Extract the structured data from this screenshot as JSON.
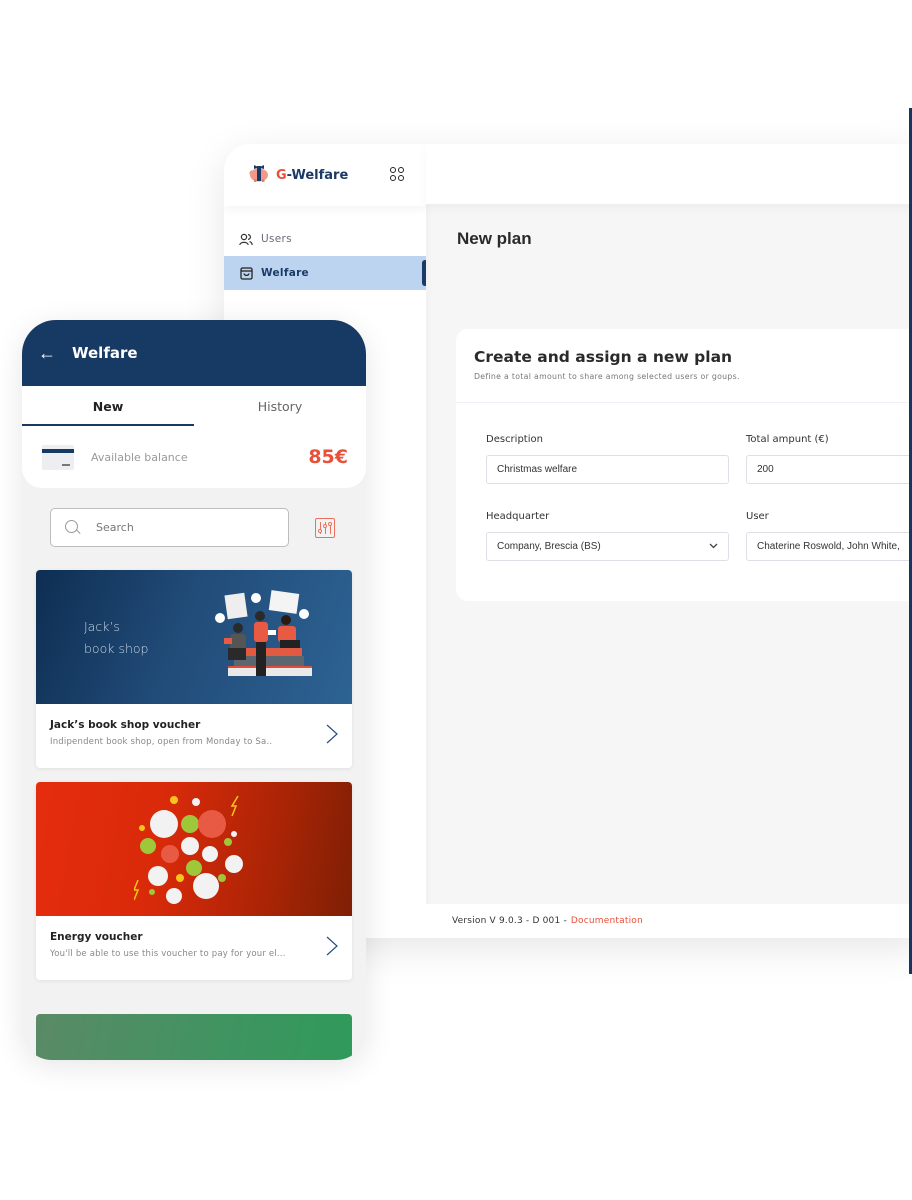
{
  "desktop": {
    "brand": {
      "logo_icon": "piggy-bank-icon",
      "name_first": "G",
      "name_rest": "-Welfare"
    },
    "apps_icon": "apps-grid-icon",
    "nav": [
      {
        "label": "Users",
        "icon": "users-icon",
        "active": false
      },
      {
        "label": "Welfare",
        "icon": "shopping-bag-icon",
        "active": true
      }
    ],
    "page_title": "New plan",
    "form_card": {
      "title": "Create and assign a new plan",
      "subtitle": "Define a total amount to share among selected users or goups.",
      "fields": {
        "description": {
          "label": "Description",
          "value": "Christmas welfare"
        },
        "total_amount": {
          "label": "Total ampunt (€)",
          "value": "200"
        },
        "headquarter": {
          "label": "Headquarter",
          "value": "Company, Brescia (BS)"
        },
        "user": {
          "label": "User",
          "value": "Chaterine Roswold, John White,"
        }
      }
    },
    "footer": {
      "version": "Version V 9.0.3 - D 001 -",
      "doc_link": "Documentation"
    }
  },
  "mobile": {
    "header": {
      "back_icon": "←",
      "title": "Welfare"
    },
    "tabs": [
      {
        "label": "New",
        "active": true
      },
      {
        "label": "History",
        "active": false
      }
    ],
    "balance": {
      "label": "Available balance",
      "value": "85€"
    },
    "search": {
      "placeholder": "Search"
    },
    "vouchers": [
      {
        "banner_line1": "Jack’s",
        "banner_line2": "book shop",
        "title": "Jack’s book shop voucher",
        "description": "Indipendent book shop, open from Monday to Sa.."
      },
      {
        "title": "Energy voucher",
        "description": "You'll be able to use this voucher to pay for your el..."
      }
    ]
  },
  "colors": {
    "brand_navy": "#173a65",
    "accent_red": "#e8503a",
    "active_nav_bg": "#bcd4f0"
  }
}
